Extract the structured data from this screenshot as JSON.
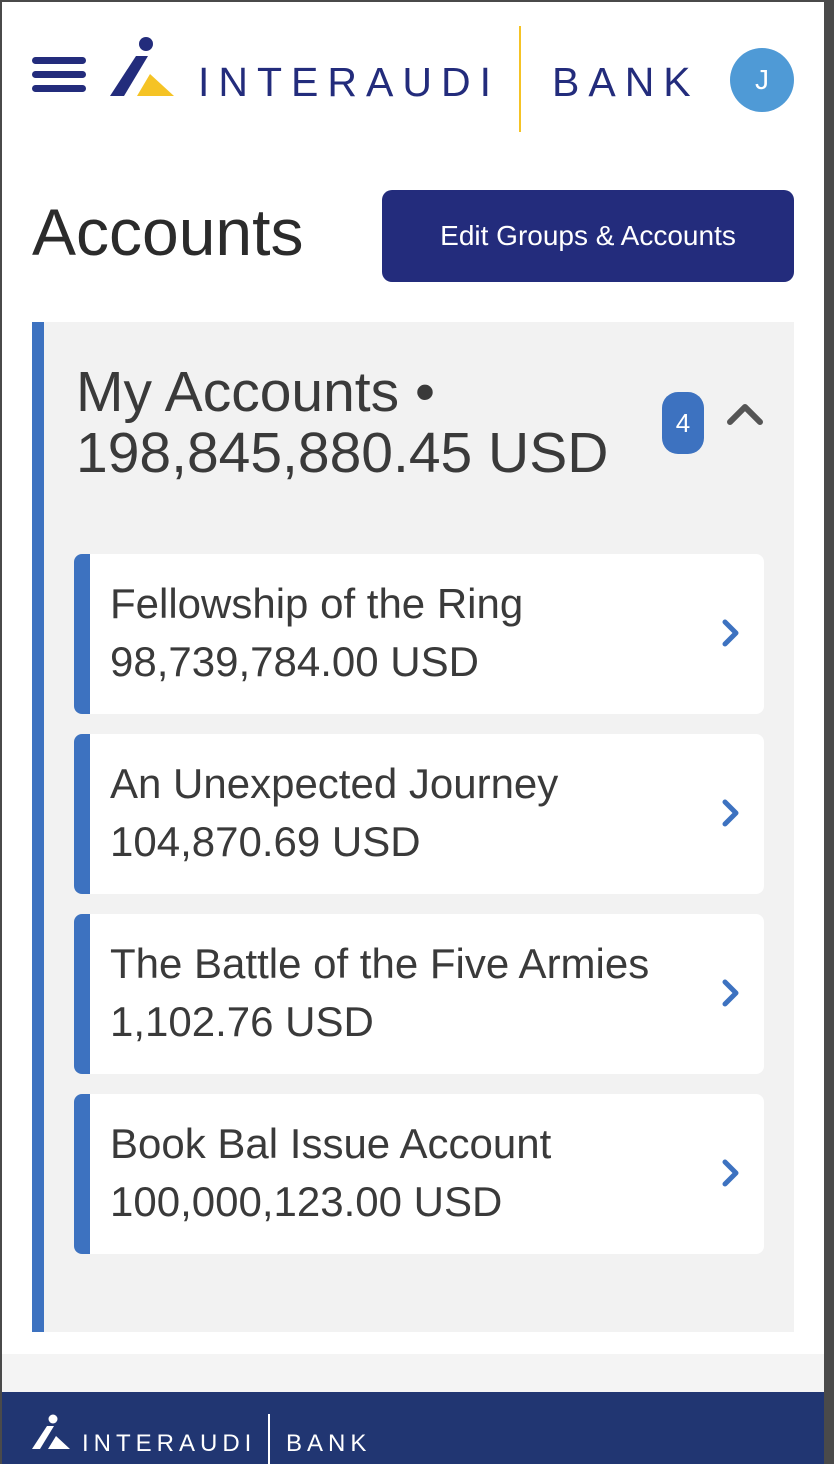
{
  "header": {
    "logo_text": "INTERAUDI",
    "logo_bank": "BANK",
    "avatar_initial": "J"
  },
  "page": {
    "title": "Accounts",
    "edit_button_label": "Edit Groups & Accounts"
  },
  "group": {
    "title": "My Accounts • 198,845,880.45 USD",
    "count": "4",
    "expanded": true,
    "accounts": [
      {
        "name": "Fellowship of the Ring",
        "balance": "98,739,784.00 USD"
      },
      {
        "name": "An Unexpected Journey",
        "balance": "104,870.69 USD"
      },
      {
        "name": "The Battle of the Five Armies",
        "balance": "1,102.76 USD"
      },
      {
        "name": "Book Bal Issue Account",
        "balance": "100,000,123.00 USD"
      }
    ]
  },
  "footer": {
    "logo_text": "INTERAUDI",
    "logo_bank": "BANK"
  },
  "colors": {
    "brand_navy": "#232c7c",
    "accent_blue": "#3d72c0",
    "accent_yellow": "#f5c325",
    "avatar_blue": "#4f9ad6",
    "footer_navy": "#213672"
  },
  "icons": {
    "menu": "hamburger-menu-icon",
    "logo": "interaudi-logo-icon",
    "collapse": "chevron-up-icon",
    "account_arrow": "chevron-right-icon"
  }
}
